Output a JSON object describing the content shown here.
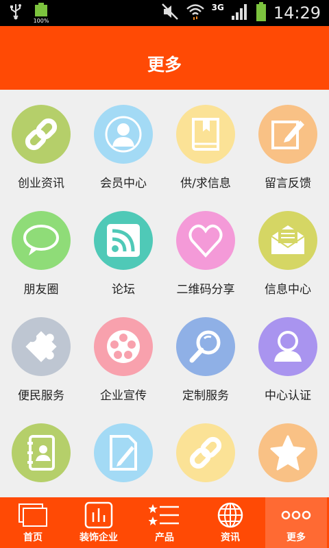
{
  "status_bar": {
    "battery_percent": "100%",
    "network": "3G",
    "time": "14:29"
  },
  "header": {
    "title": "更多"
  },
  "grid": {
    "items": [
      {
        "label": "创业资讯",
        "icon": "link-icon",
        "color": "#b5cf6a"
      },
      {
        "label": "会员中心",
        "icon": "user-icon",
        "color": "#a3daf5"
      },
      {
        "label": "供/求信息",
        "icon": "book-icon",
        "color": "#fbe296"
      },
      {
        "label": "留言反馈",
        "icon": "edit-icon",
        "color": "#f9c185"
      },
      {
        "label": "朋友圈",
        "icon": "chat-bubble-icon",
        "color": "#8fdc78"
      },
      {
        "label": "论坛",
        "icon": "rss-icon",
        "color": "#4fc9b7"
      },
      {
        "label": "二维码分享",
        "icon": "heart-icon",
        "color": "#f49ad8"
      },
      {
        "label": "信息中心",
        "icon": "envelope-icon",
        "color": "#d5d664"
      },
      {
        "label": "便民服务",
        "icon": "puzzle-icon",
        "color": "#bec6d2"
      },
      {
        "label": "企业宣传",
        "icon": "film-reel-icon",
        "color": "#f8a1ad"
      },
      {
        "label": "定制服务",
        "icon": "magnifier-icon",
        "color": "#8fb0e6"
      },
      {
        "label": "中心认证",
        "icon": "user-badge-icon",
        "color": "#a994ef"
      },
      {
        "label": "",
        "icon": "contacts-book-icon",
        "color": "#b5cf6a"
      },
      {
        "label": "",
        "icon": "document-edit-icon",
        "color": "#a3daf5"
      },
      {
        "label": "",
        "icon": "link-icon",
        "color": "#fbe296"
      },
      {
        "label": "",
        "icon": "star-icon",
        "color": "#f9c185"
      }
    ]
  },
  "tabbar": {
    "items": [
      {
        "label": "首页",
        "icon": "home-window-icon"
      },
      {
        "label": "装饰企业",
        "icon": "bar-chart-icon"
      },
      {
        "label": "产品",
        "icon": "star-list-icon"
      },
      {
        "label": "资讯",
        "icon": "globe-icon"
      },
      {
        "label": "更多",
        "icon": "more-dots-icon"
      }
    ],
    "active_index": 4
  }
}
